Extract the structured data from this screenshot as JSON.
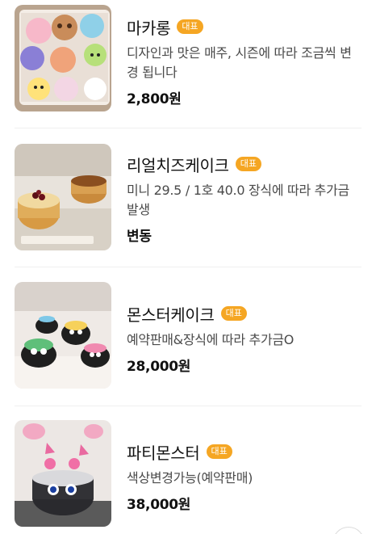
{
  "items": [
    {
      "name": "마카롱",
      "badge": "대표",
      "description": "디자인과 맛은 매주, 시즌에 따라 조금씩 변경 됩니다",
      "price": "2,800원",
      "image_icon": "macaron-box-image"
    },
    {
      "name": "리얼치즈케이크",
      "badge": "대표",
      "description": "미니 29.5 / 1호 40.0 장식에 따라 추가금 발생",
      "price": "변동",
      "image_icon": "cheesecake-image"
    },
    {
      "name": "몬스터케이크",
      "badge": "대표",
      "description": "예약판매&장식에 따라 추가금O",
      "price": "28,000원",
      "image_icon": "monster-cakes-image"
    },
    {
      "name": "파티몬스터",
      "badge": "대표",
      "description": "색상변경가능(예약판매)",
      "price": "38,000원",
      "image_icon": "party-monster-cake-image"
    }
  ],
  "colors": {
    "badge": "#f5a623",
    "price": "#111111",
    "description": "#4a4a4a",
    "divider": "#efefef"
  }
}
